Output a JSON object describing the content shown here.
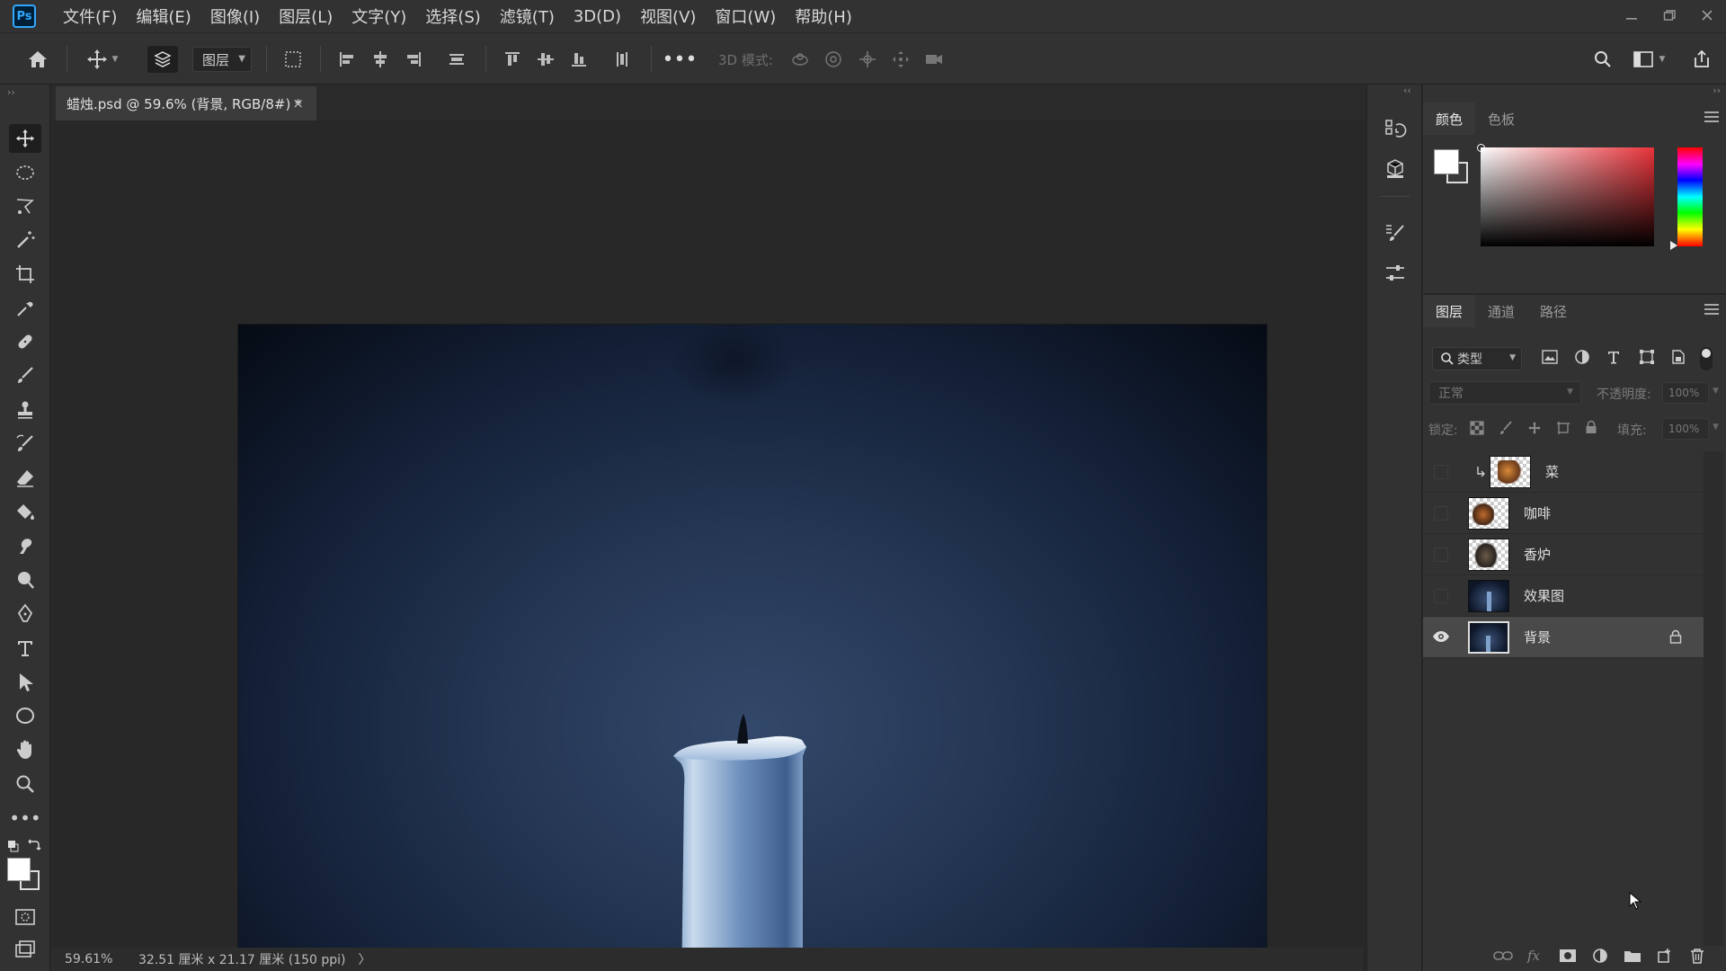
{
  "app": {
    "logo": "Ps",
    "menu": [
      "文件(F)",
      "编辑(E)",
      "图像(I)",
      "图层(L)",
      "文字(Y)",
      "选择(S)",
      "滤镜(T)",
      "3D(D)",
      "视图(V)",
      "窗口(W)",
      "帮助(H)"
    ]
  },
  "options_bar": {
    "auto_select_target": "图层",
    "mode_3d_label": "3D 模式:"
  },
  "document": {
    "tab_title": "蜡烛.psd @ 59.6% (背景, RGB/8#) *",
    "close_glyph": "×"
  },
  "status": {
    "zoom": "59.61%",
    "doc_size": "32.51 厘米 x 21.17 厘米 (150 ppi)",
    "arrow": "〉"
  },
  "color_panel": {
    "tabs": [
      "颜色",
      "色板"
    ],
    "foreground": "#ffffff",
    "background": "#3a3a3a"
  },
  "layers_panel": {
    "tabs": [
      "图层",
      "通道",
      "路径"
    ],
    "filter_kind": "类型",
    "blend_mode": "正常",
    "opacity_label": "不透明度:",
    "opacity_value": "100%",
    "lock_label": "锁定:",
    "fill_label": "填充:",
    "fill_value": "100%",
    "layers": [
      {
        "name": "菜",
        "visible": false,
        "clipped": true,
        "selected": false,
        "locked": false
      },
      {
        "name": "咖啡",
        "visible": false,
        "clipped": false,
        "selected": false,
        "locked": false
      },
      {
        "name": "香炉",
        "visible": false,
        "clipped": false,
        "selected": false,
        "locked": false
      },
      {
        "name": "效果图",
        "visible": false,
        "clipped": false,
        "selected": false,
        "locked": false
      },
      {
        "name": "背景",
        "visible": true,
        "clipped": false,
        "selected": true,
        "locked": true
      }
    ]
  },
  "colors": {
    "accent": "#31a8ff",
    "menu_highlight": "#e07a3a"
  }
}
